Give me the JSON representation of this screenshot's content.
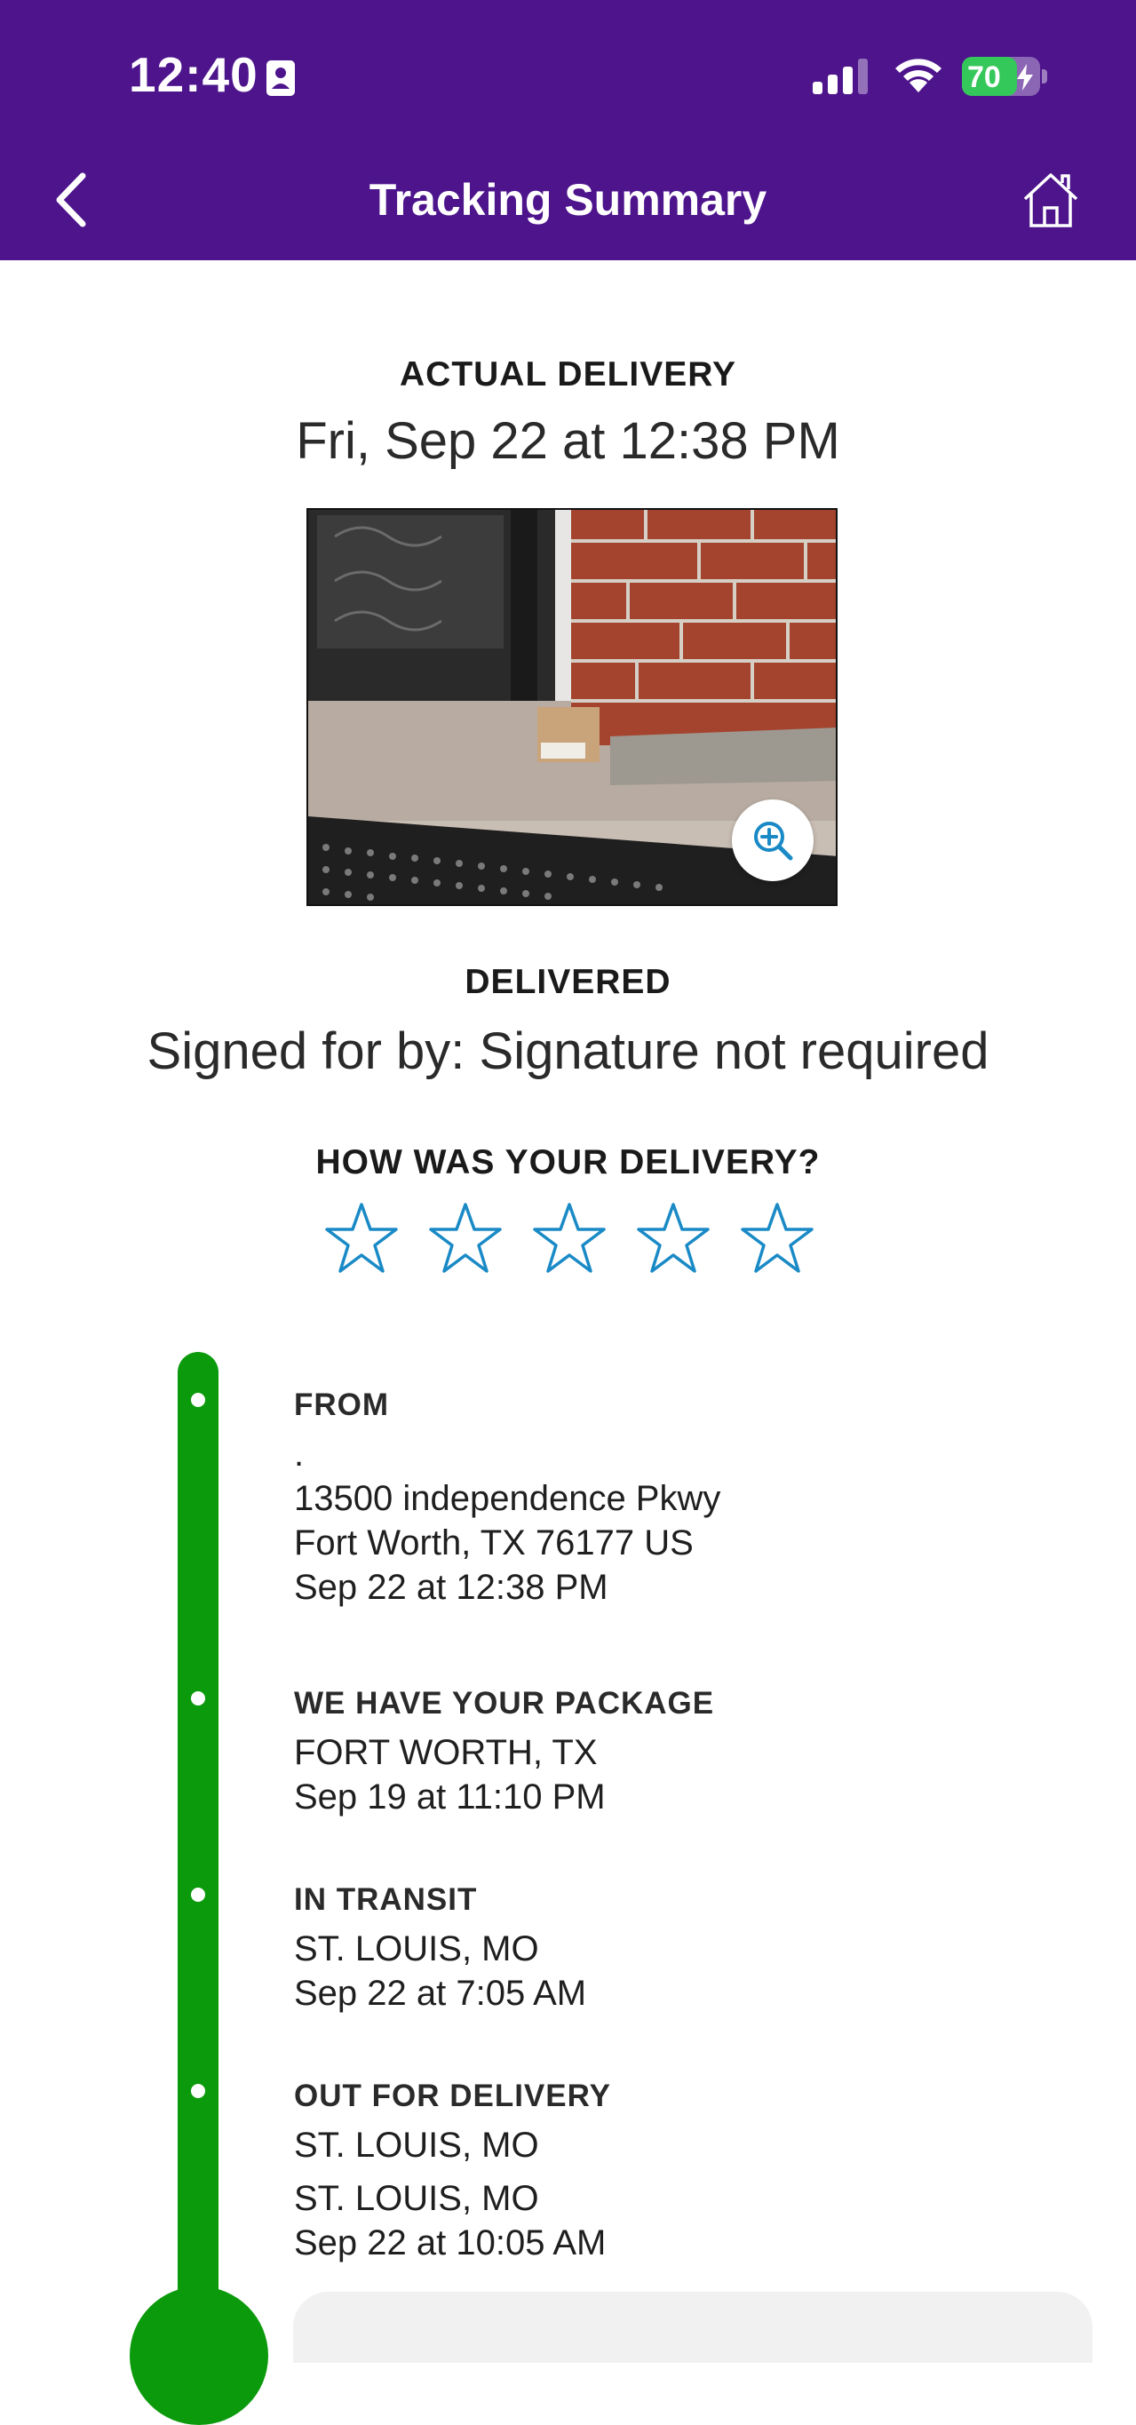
{
  "status_bar": {
    "time": "12:40",
    "battery_percent": "70",
    "battery_level": 0.7,
    "icons": [
      "contact-card-icon",
      "cellular-signal-icon",
      "wifi-icon",
      "battery-charging-icon"
    ]
  },
  "header": {
    "title": "Tracking Summary",
    "back_icon": "chevron-left-icon",
    "home_icon": "home-icon",
    "background_color": "#4d148c"
  },
  "delivery": {
    "actual_label": "ACTUAL DELIVERY",
    "actual_date": "Fri, Sep 22 at 12:38 PM",
    "photo_zoom_icon": "zoom-in-icon",
    "status_label": "DELIVERED",
    "signed_text": "Signed for by: Signature not required"
  },
  "rating": {
    "prompt": "HOW WAS YOUR DELIVERY?",
    "stars_total": 5,
    "stars_selected": 0,
    "star_color": "#1a8ac6"
  },
  "timeline": {
    "rail_color": "#0b9a0b",
    "events": [
      {
        "title": "FROM",
        "lines": [
          ".",
          "13500 independence Pkwy",
          "Fort Worth, TX 76177 US",
          "Sep 22 at 12:38 PM"
        ]
      },
      {
        "title": "WE HAVE YOUR PACKAGE",
        "lines": [
          "FORT WORTH, TX",
          "Sep 19 at 11:10 PM"
        ]
      },
      {
        "title": "IN TRANSIT",
        "lines": [
          "ST. LOUIS, MO",
          "Sep 22 at 7:05 AM"
        ]
      },
      {
        "title": "OUT FOR DELIVERY",
        "lines": [
          "ST. LOUIS, MO",
          "ST. LOUIS, MO",
          "Sep 22 at 10:05 AM"
        ]
      }
    ]
  }
}
